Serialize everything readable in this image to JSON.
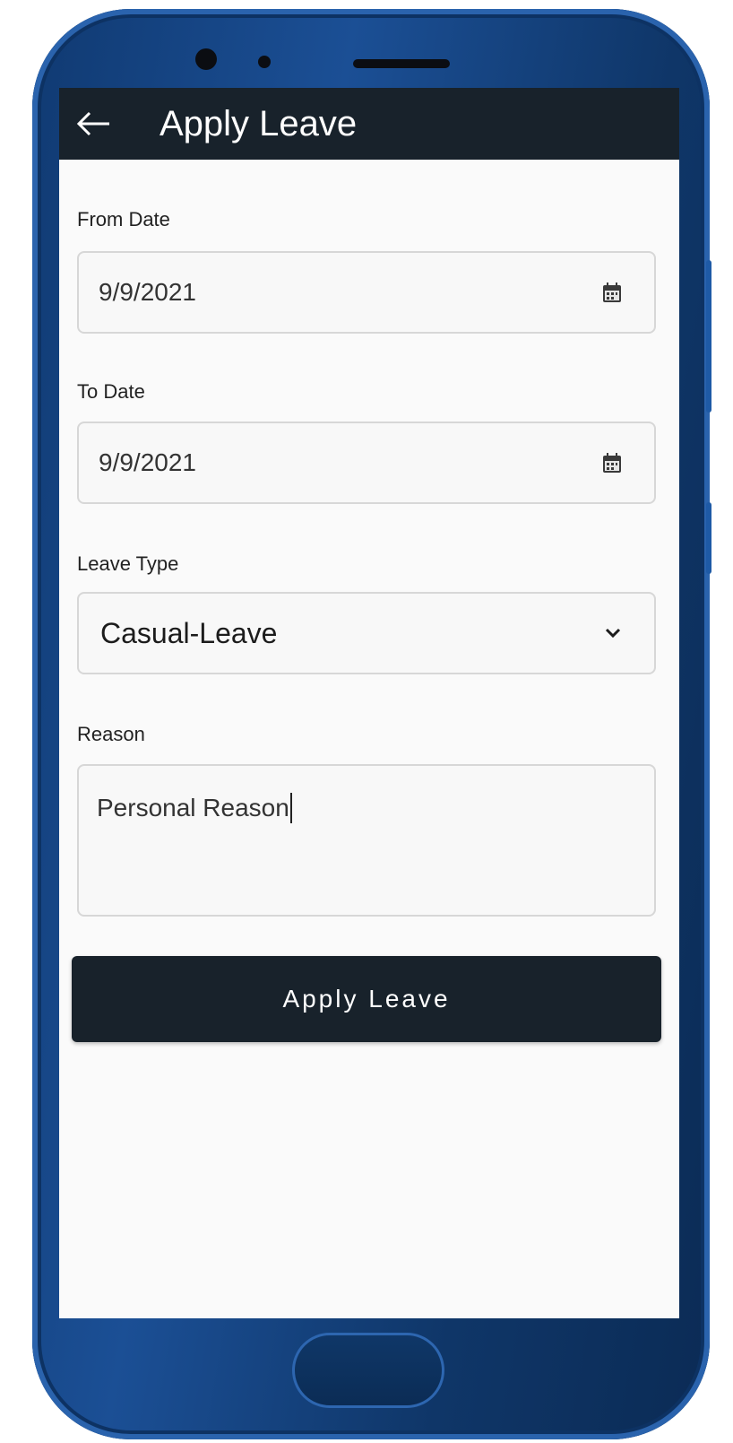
{
  "header": {
    "title": "Apply Leave",
    "back_icon": "arrow-left-icon"
  },
  "form": {
    "from_date": {
      "label": "From Date",
      "value": "9/9/2021",
      "icon": "calendar-icon"
    },
    "to_date": {
      "label": "To Date",
      "value": "9/9/2021",
      "icon": "calendar-icon"
    },
    "leave_type": {
      "label": "Leave Type",
      "selected": "Casual-Leave",
      "icon": "chevron-down-icon"
    },
    "reason": {
      "label": "Reason",
      "value": "Personal Reason"
    },
    "submit_label": "Apply Leave"
  },
  "colors": {
    "appbar": "#18222b",
    "button": "#18222b",
    "phone_body": "#1b4f95",
    "screen_bg": "#fafafa"
  }
}
